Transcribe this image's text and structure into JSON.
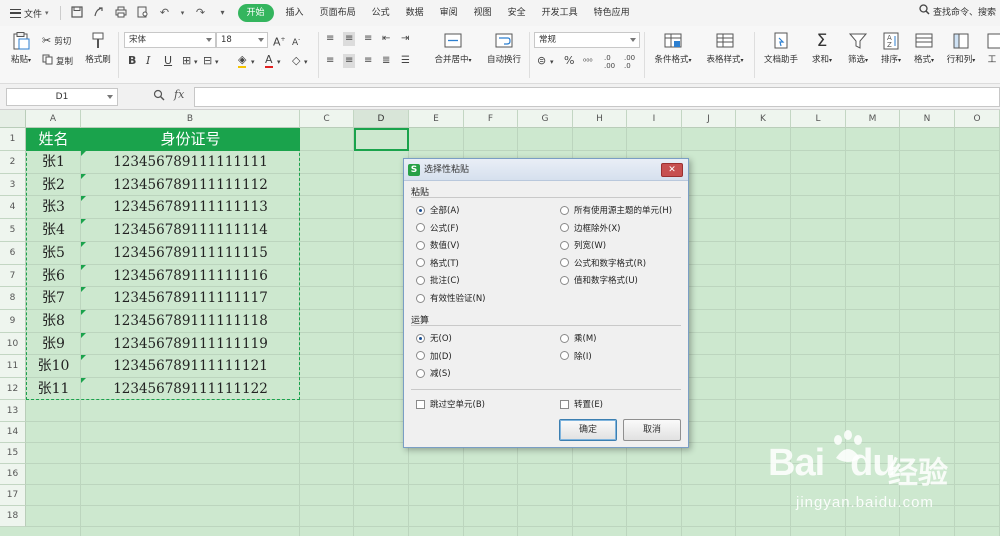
{
  "menubar": {
    "file_label": "文件",
    "tabs": [
      "开始",
      "插入",
      "页面布局",
      "公式",
      "数据",
      "审阅",
      "视图",
      "安全",
      "开发工具",
      "特色应用"
    ],
    "active_tab": "开始",
    "search_label": "查找命令、搜索"
  },
  "ribbon": {
    "paste": "粘贴",
    "cut": "剪切",
    "copy": "复制",
    "format_painter": "格式刷",
    "font_name": "宋体",
    "font_size": "18",
    "merge_center": "合并居中",
    "wrap_text": "自动换行",
    "number_format": "常规",
    "conditional_format": "条件格式",
    "table_style": "表格样式",
    "doc_assistant": "文档助手",
    "sum": "求和",
    "filter": "筛选",
    "sort": "排序",
    "format": "格式",
    "rows_cols": "行和列",
    "worksheet": "工"
  },
  "formula_bar": {
    "name_box": "D1",
    "fx": "fx",
    "formula": ""
  },
  "grid": {
    "columns": [
      "A",
      "B",
      "C",
      "D",
      "E",
      "F",
      "G",
      "H",
      "I",
      "J",
      "K",
      "L",
      "M",
      "N",
      "O"
    ],
    "rows": [
      "1",
      "2",
      "3",
      "4",
      "5",
      "6",
      "7",
      "8",
      "9",
      "10",
      "11",
      "12",
      "13",
      "14",
      "15",
      "16",
      "17",
      "18"
    ],
    "header": {
      "name": "姓名",
      "id": "身份证号"
    },
    "records": [
      {
        "name": "张1",
        "id": "123456789111111111"
      },
      {
        "name": "张2",
        "id": "123456789111111112"
      },
      {
        "name": "张3",
        "id": "123456789111111113"
      },
      {
        "name": "张4",
        "id": "123456789111111114"
      },
      {
        "name": "张5",
        "id": "123456789111111115"
      },
      {
        "name": "张6",
        "id": "123456789111111116"
      },
      {
        "name": "张7",
        "id": "123456789111111117"
      },
      {
        "name": "张8",
        "id": "123456789111111118"
      },
      {
        "name": "张9",
        "id": "123456789111111119"
      },
      {
        "name": "张10",
        "id": "123456789111111121"
      },
      {
        "name": "张11",
        "id": "123456789111111122"
      }
    ],
    "selected_cell": "D1",
    "accent_color": "#1aa34c"
  },
  "dialog": {
    "title": "选择性粘贴",
    "close": "✕",
    "paste_section": "粘贴",
    "paste_options_left": [
      {
        "label": "全部(A)",
        "checked": true
      },
      {
        "label": "公式(F)",
        "checked": false
      },
      {
        "label": "数值(V)",
        "checked": false
      },
      {
        "label": "格式(T)",
        "checked": false
      },
      {
        "label": "批注(C)",
        "checked": false
      },
      {
        "label": "有效性验证(N)",
        "checked": false
      }
    ],
    "paste_options_right": [
      {
        "label": "所有使用源主题的单元(H)",
        "checked": false
      },
      {
        "label": "边框除外(X)",
        "checked": false
      },
      {
        "label": "列宽(W)",
        "checked": false
      },
      {
        "label": "公式和数字格式(R)",
        "checked": false
      },
      {
        "label": "值和数字格式(U)",
        "checked": false
      }
    ],
    "operation_section": "运算",
    "operation_left": [
      {
        "label": "无(O)",
        "checked": true
      },
      {
        "label": "加(D)",
        "checked": false
      },
      {
        "label": "减(S)",
        "checked": false
      }
    ],
    "operation_right": [
      {
        "label": "乘(M)",
        "checked": false
      },
      {
        "label": "除(I)",
        "checked": false
      }
    ],
    "skip_blanks": "跳过空单元(B)",
    "transpose": "转置(E)",
    "ok": "确定",
    "cancel": "取消"
  },
  "watermark": {
    "brand": "Bai",
    "brand2": "du",
    "cn": "经验",
    "url": "jingyan.baidu.com"
  }
}
